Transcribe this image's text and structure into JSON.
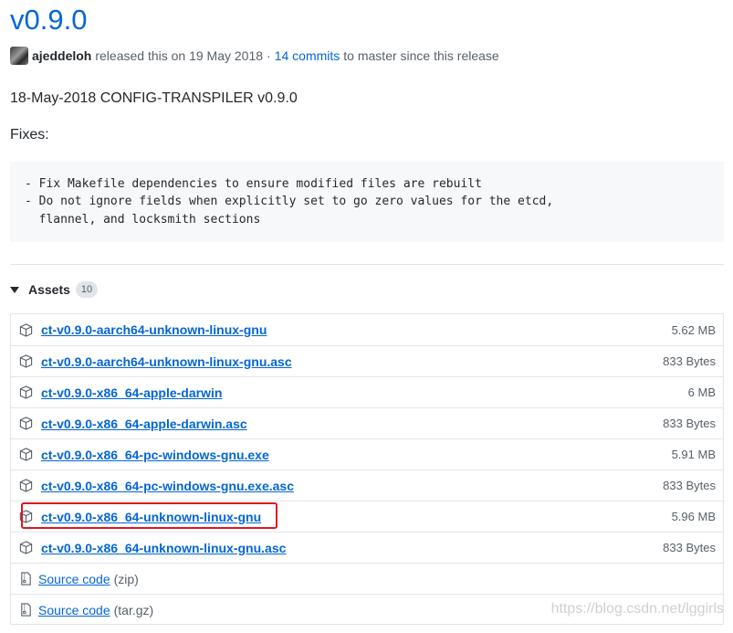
{
  "release": {
    "tag": "v0.9.0",
    "author": "ajeddeloh",
    "released_text": "released this on 19 May 2018",
    "separator": "·",
    "commits_link": "14 commits",
    "commits_suffix": "to master since this release",
    "headline": "18-May-2018 CONFIG-TRANSPILER v0.9.0",
    "fixes_label": "Fixes:",
    "notes_code": "- Fix Makefile dependencies to ensure modified files are rebuilt\n- Do not ignore fields when explicitly set to go zero values for the etcd,\n  flannel, and locksmith sections"
  },
  "assets": {
    "label": "Assets",
    "count": "10",
    "files": [
      {
        "name": "ct-v0.9.0-aarch64-unknown-linux-gnu",
        "size": "5.62 MB"
      },
      {
        "name": "ct-v0.9.0-aarch64-unknown-linux-gnu.asc",
        "size": "833 Bytes"
      },
      {
        "name": "ct-v0.9.0-x86_64-apple-darwin",
        "size": "6 MB"
      },
      {
        "name": "ct-v0.9.0-x86_64-apple-darwin.asc",
        "size": "833 Bytes"
      },
      {
        "name": "ct-v0.9.0-x86_64-pc-windows-gnu.exe",
        "size": "5.91 MB"
      },
      {
        "name": "ct-v0.9.0-x86_64-pc-windows-gnu.exe.asc",
        "size": "833 Bytes"
      },
      {
        "name": "ct-v0.9.0-x86_64-unknown-linux-gnu",
        "size": "5.96 MB"
      },
      {
        "name": "ct-v0.9.0-x86_64-unknown-linux-gnu.asc",
        "size": "833 Bytes"
      }
    ],
    "source": [
      {
        "label": "Source code",
        "ext": "(zip)"
      },
      {
        "label": "Source code",
        "ext": "(tar.gz)"
      }
    ]
  },
  "icons": {
    "asset": "package-icon",
    "source": "file-zip-icon",
    "toggle": "caret-down-icon"
  },
  "colors": {
    "link": "#0366d6",
    "highlight_box": "#e0161f"
  },
  "watermark": "https://blog.csdn.net/lggirls"
}
